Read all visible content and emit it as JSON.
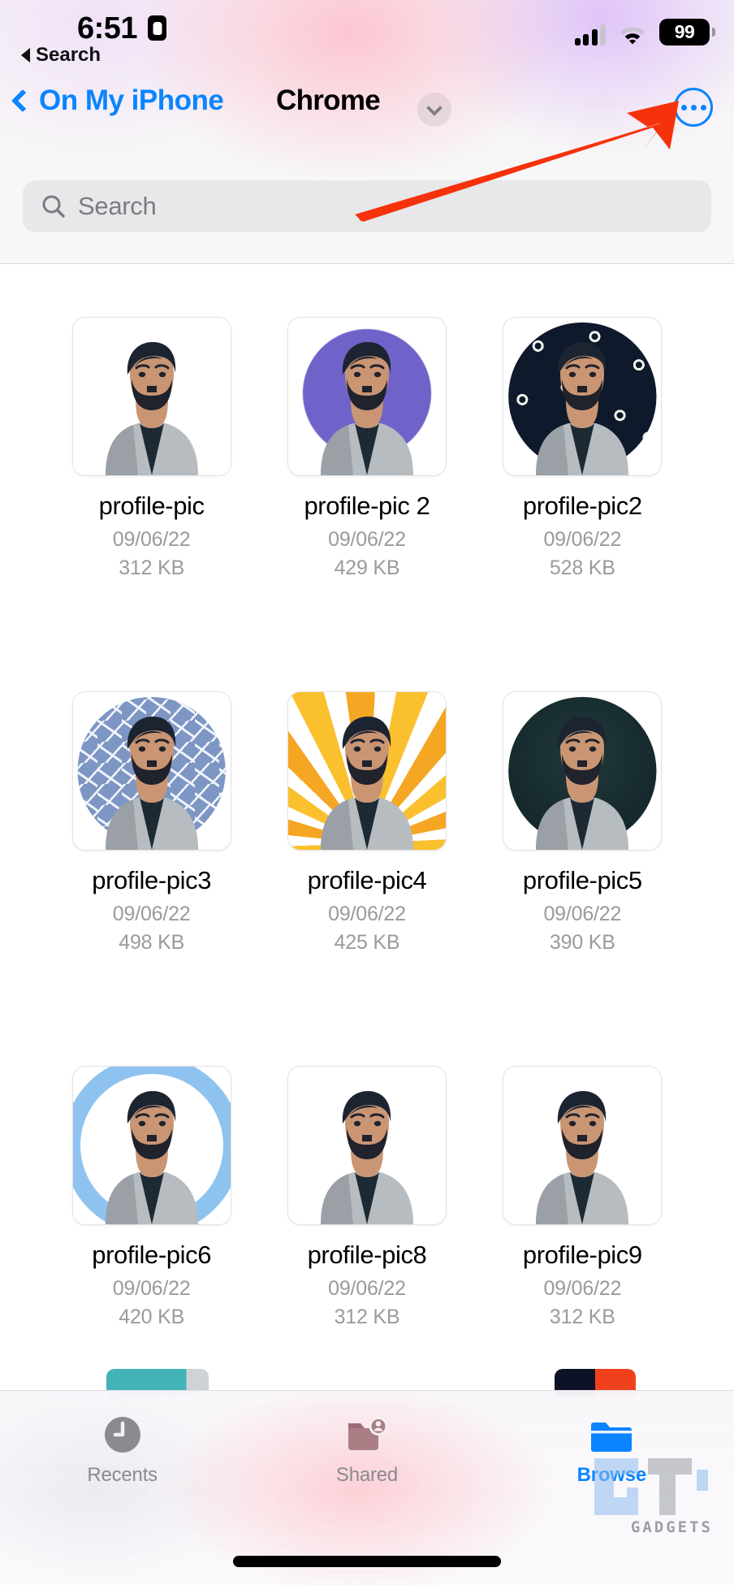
{
  "status_bar": {
    "time": "6:51",
    "recording_icon": "screen-recording-icon",
    "signal_icon": "cellular-signal-icon",
    "wifi_icon": "wifi-icon",
    "battery_level": "99"
  },
  "back_to_app": {
    "label": "Search",
    "icon": "back-triangle-icon"
  },
  "nav": {
    "back_label": "On My iPhone",
    "back_icon": "chevron-left-icon",
    "title": "Chrome",
    "title_chevron_icon": "chevron-down-icon",
    "more_icon": "ellipsis-circle-icon",
    "accent_color": "#0a84ff"
  },
  "search": {
    "placeholder": "Search",
    "icon": "search-icon",
    "value": ""
  },
  "files": [
    {
      "name": "profile-pic",
      "date": "09/06/22",
      "size": "312 KB",
      "style": "plain"
    },
    {
      "name": "profile-pic 2",
      "date": "09/06/22",
      "size": "429 KB",
      "style": "halftone"
    },
    {
      "name": "profile-pic2",
      "date": "09/06/22",
      "size": "528 KB",
      "style": "maze"
    },
    {
      "name": "profile-pic3",
      "date": "09/06/22",
      "size": "498 KB",
      "style": "confetti"
    },
    {
      "name": "profile-pic4",
      "date": "09/06/22",
      "size": "425 KB",
      "style": "rays"
    },
    {
      "name": "profile-pic5",
      "date": "09/06/22",
      "size": "390 KB",
      "style": "teal"
    },
    {
      "name": "profile-pic6",
      "date": "09/06/22",
      "size": "420 KB",
      "style": "ring"
    },
    {
      "name": "profile-pic8",
      "date": "09/06/22",
      "size": "312 KB",
      "style": "plain"
    },
    {
      "name": "profile-pic9",
      "date": "09/06/22",
      "size": "312 KB",
      "style": "plain"
    }
  ],
  "tab_bar": {
    "items": [
      {
        "label": "Recents",
        "icon": "clock-icon",
        "active": false
      },
      {
        "label": "Shared",
        "icon": "shared-folder-icon",
        "active": false
      },
      {
        "label": "Browse",
        "icon": "folder-icon",
        "active": true
      }
    ],
    "active_color": "#0a84ff",
    "inactive_color": "#8a8a8f"
  },
  "annotation": {
    "arrow_color": "#f5320c",
    "points_to": "more-button"
  },
  "watermark": {
    "text": "GADGETS"
  }
}
